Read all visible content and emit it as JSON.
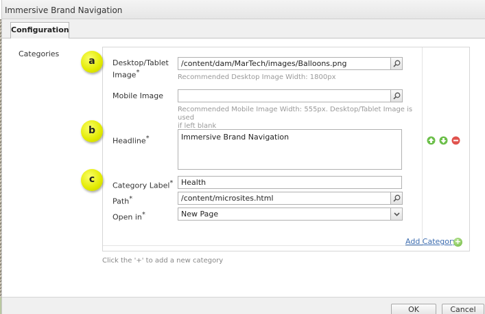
{
  "dialog": {
    "title": "Immersive Brand Navigation",
    "tabs": [
      "Configuration"
    ]
  },
  "categories_label": "Categories",
  "fields": {
    "desktop_image": {
      "label_line1": "Desktop/Tablet",
      "label_line2": "Image",
      "required": "*",
      "value": "/content/dam/MarTech/images/Balloons.png",
      "hint": "Recommended Desktop Image Width: 1800px"
    },
    "mobile_image": {
      "label": "Mobile Image",
      "value": "",
      "hint_line1": "Recommended Mobile Image Width: 555px. Desktop/Tablet Image is used",
      "hint_line2": "if left blank"
    },
    "headline": {
      "label": "Headline",
      "required": "*",
      "value": "Immersive Brand Navigation"
    },
    "category_label": {
      "label": "Category Label",
      "required": "*",
      "value": "Health"
    },
    "path": {
      "label": "Path",
      "required": "*",
      "value": "/content/microsites.html"
    },
    "open_in": {
      "label": "Open in",
      "required": "*",
      "selected": "New Page"
    }
  },
  "callouts": [
    "a",
    "b",
    "c"
  ],
  "icons": {
    "search": "magnifier-icon",
    "move_up": "arrow-up-icon",
    "move_down": "arrow-down-icon",
    "remove": "remove-icon",
    "add": "add-icon"
  },
  "add_category": "Add Category",
  "add_symbol": "+",
  "footer_hint": "Click the '+' to add a new category",
  "buttons": {
    "ok": "OK",
    "cancel": "Cancel"
  },
  "colors": {
    "callout": "#e2ea00",
    "link": "#3d6db0",
    "up": "#5cb043",
    "down": "#5cb043",
    "remove": "#d9534f"
  }
}
